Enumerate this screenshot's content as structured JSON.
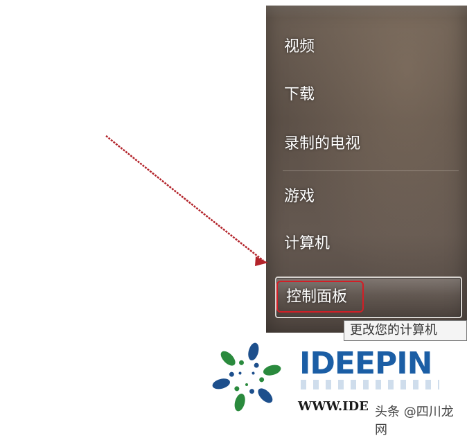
{
  "start_menu": {
    "items": [
      {
        "label": "视频"
      },
      {
        "label": "下载"
      },
      {
        "label": "录制的电视"
      },
      {
        "label": "游戏"
      },
      {
        "label": "计算机"
      },
      {
        "label": "控制面板",
        "state": "hover"
      }
    ],
    "tooltip": "更改您的计算机"
  },
  "annotation": {
    "arrow_color": "#b3232a",
    "highlight_color": "#d21e26"
  },
  "watermark": {
    "brand": "IDEEPIN",
    "url": "WWW.IDE",
    "overlay_text": "头条 @四川龙网",
    "brand_color": "#1b5ea5"
  }
}
